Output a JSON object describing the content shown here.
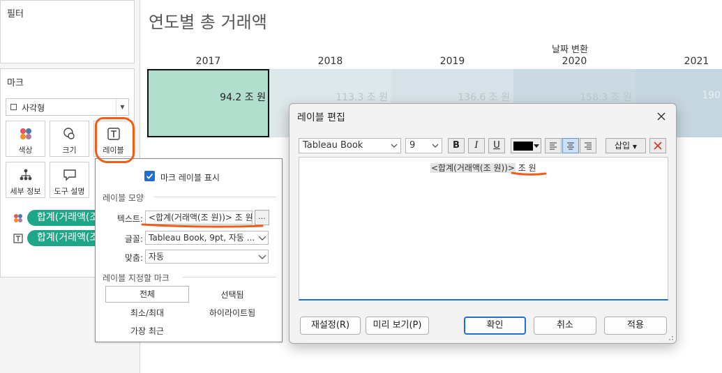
{
  "shelves": {
    "filters_title": "필터",
    "marks_title": "마크",
    "mark_type": "사각형",
    "buttons": {
      "color": "색상",
      "size": "크기",
      "label": "레이블",
      "detail": "세부 정보",
      "tooltip": "도구 설명"
    },
    "pills": [
      "합계(거래액(조 원))",
      "합계(거래액(조 원))"
    ]
  },
  "view": {
    "title": "연도별 총 거래액",
    "column_group": "날짜 변환",
    "header_color": "#b7dccf"
  },
  "chart_data": {
    "type": "heatmap",
    "categories": [
      "2017",
      "2018",
      "2019",
      "2020",
      "2021"
    ],
    "values": [
      94.2,
      113.3,
      136.6,
      158.3,
      190
    ],
    "value_labels": [
      "94.2 조 원",
      "113.3 조 원",
      "136.6 조 원",
      "158.3 조 원",
      "190"
    ],
    "title": "연도별 총 거래액",
    "xlabel": "날짜 변환",
    "unit": "조 원",
    "selected_index": 0,
    "colors": [
      "#b2dfcd",
      "#dde8ea",
      "#d6e2e7",
      "#cbdae2",
      "#c6d6e0"
    ]
  },
  "popover": {
    "show_labels": "마크 레이블 표시",
    "appearance_title": "레이블 모양",
    "text_label": "텍스트:",
    "text_value": "<합계(거래액(조 원))> 조 원",
    "more_button": "...",
    "font_label": "글꼴:",
    "font_value": "Tableau Book, 9pt, 자동 ...",
    "align_label": "맞춤:",
    "align_value": "자동",
    "marks_to_label_title": "레이블 지정할 마크",
    "options": {
      "all": "전체",
      "selected": "선택됨",
      "minmax": "최소/최대",
      "highlighted": "하이라이트됨",
      "most_recent": "가장 최근"
    }
  },
  "dialog": {
    "title": "레이블 편집",
    "font_family": "Tableau Book",
    "font_size": "9",
    "bold": "B",
    "italic": "I",
    "underline": "U",
    "text_color": "#000000",
    "insert": "삽입",
    "editor_field": "<합계(거래액(조 원))>",
    "editor_suffix": "조 원",
    "buttons": {
      "reset": "재설정(R)",
      "preview": "미리 보기(P)",
      "ok": "확인",
      "cancel": "취소",
      "apply": "적용"
    }
  },
  "accent": {
    "annotation": "#f25c19",
    "selection": "#1f6fd0",
    "pill": "#1ea688"
  }
}
